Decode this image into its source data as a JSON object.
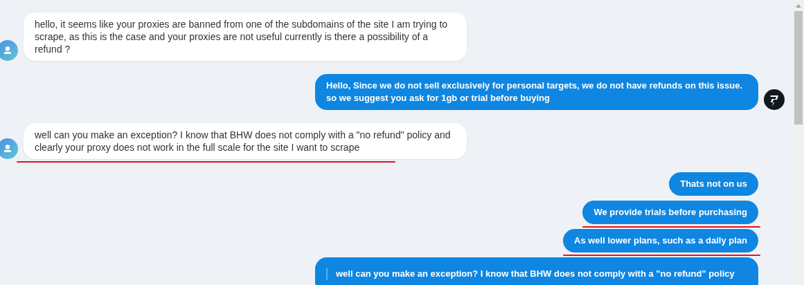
{
  "messages": [
    {
      "kind": "incoming",
      "avatar": true,
      "underlined": false,
      "text": "hello, it seems like your proxies are banned from one of the subdomains of the site I am trying to scrape, as this is the case and your proxies are not useful currently is there a possibility of a refund ?"
    },
    {
      "kind": "outgoing",
      "avatar": true,
      "underlined": false,
      "text": "Hello, Since we do not sell exclusively for personal targets, we do not have refunds on this issue. so we suggest you ask for 1gb or trial before buying"
    },
    {
      "kind": "incoming",
      "avatar": true,
      "underlined": true,
      "text": "well can you make an exception? I know that BHW does not comply with a \"no refund\" policy and clearly your proxy does not work in the full scale for the site I want to scrape"
    },
    {
      "kind": "outgoing",
      "avatar": false,
      "underlined": false,
      "text": "Thats not on us"
    },
    {
      "kind": "outgoing",
      "avatar": false,
      "underlined": true,
      "text": "We provide trials before purchasing"
    },
    {
      "kind": "outgoing",
      "avatar": false,
      "underlined": true,
      "text": "As well lower plans, such as a daily plan"
    },
    {
      "kind": "quote",
      "avatar": false,
      "underlined": false,
      "text": "well can you make an exception? I know that BHW does not comply with a \"no refund\" policy"
    }
  ]
}
